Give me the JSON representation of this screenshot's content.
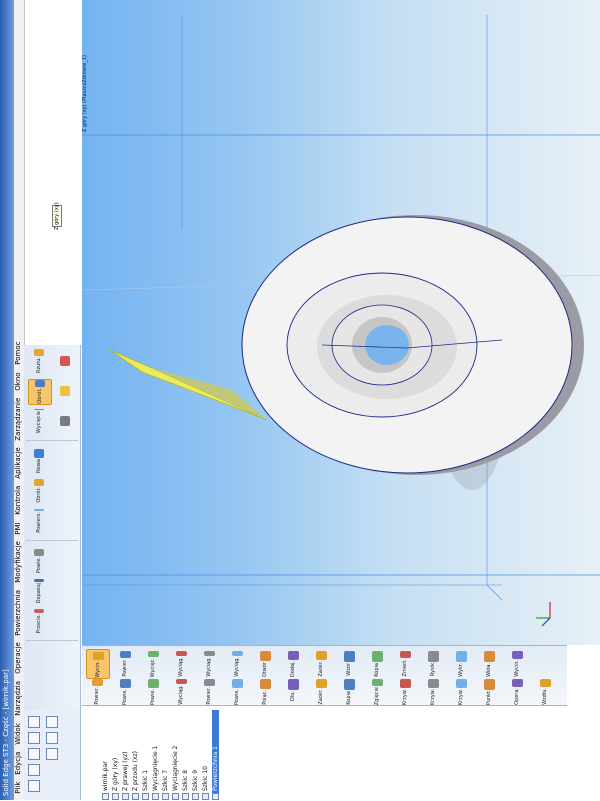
{
  "window": {
    "title": "Solid Edge ST3 - Część - [wirnik.par]"
  },
  "menu": [
    "Plik",
    "Edycja",
    "Widok",
    "Narzędzia",
    "Operacje",
    "Powierzchnia",
    "Modyfikacje",
    "PMI",
    "Kontrola",
    "Aplikacje",
    "Zarządzanie",
    "Okno",
    "Pomoc"
  ],
  "ribbon": {
    "groups": [
      {
        "buttons": [
          "Rzutu.",
          "Obrót.",
          "Wycięcie"
        ]
      },
      {
        "buttons": [
          "Nowa",
          "Obrót.",
          "Powierz."
        ]
      },
      {
        "buttons": [
          "Powie.",
          "Dopasuj",
          "Przecie."
        ]
      }
    ]
  },
  "features": {
    "row1": [
      "Wycin.",
      "Powier.",
      "Wycięc.",
      "Wyciąg.",
      "Wyciąg.",
      "Wyciąg.",
      "Otwór",
      "Dodaj.",
      "Zaokr.",
      "Wzór",
      "Kopia",
      "Zmień.",
      "Rysik",
      "Wykr.",
      "Wkła.",
      "Wycin."
    ],
    "row2": [
      "Powier.",
      "Powie.",
      "Powie.",
      "Wyciąg.",
      "Powier.",
      "Powie.",
      "Połąc.",
      "Dłu.",
      "Zaokr.",
      "Kopia",
      "Zgięcie",
      "Krzyw.",
      "Krzyw.",
      "Krzyw.",
      "Punkt",
      "Opera.",
      "Wzdłu."
    ]
  },
  "pathfinder": {
    "items": [
      {
        "label": "wirnik.par",
        "selected": false
      },
      {
        "label": "Z góry (xy)",
        "selected": false
      },
      {
        "label": "Z prawej (yz)",
        "selected": false
      },
      {
        "label": "Z przodu (xz)",
        "selected": false
      },
      {
        "label": "Szkic 1",
        "selected": false
      },
      {
        "label": "Wyciągnięcie 1",
        "selected": false
      },
      {
        "label": "Szkic 7",
        "selected": false
      },
      {
        "label": "Wyciągnięcie 2",
        "selected": false
      },
      {
        "label": "Szkic 8",
        "selected": false
      },
      {
        "label": "Szkic 9",
        "selected": false
      },
      {
        "label": "Szkic 10",
        "selected": false
      },
      {
        "label": "Powierzchnia 1",
        "selected": true
      }
    ]
  },
  "viewport": {
    "plane_label": "Z góry (xy) (PłaszczZdrowie_1)",
    "view_tag": "Z góry (xy)",
    "sketch_color": "#f5f250",
    "edge_color": "#1d2a8a"
  },
  "colors": {
    "ribbon_accent": "#f7c66a",
    "selection": "#3a7bd5"
  }
}
